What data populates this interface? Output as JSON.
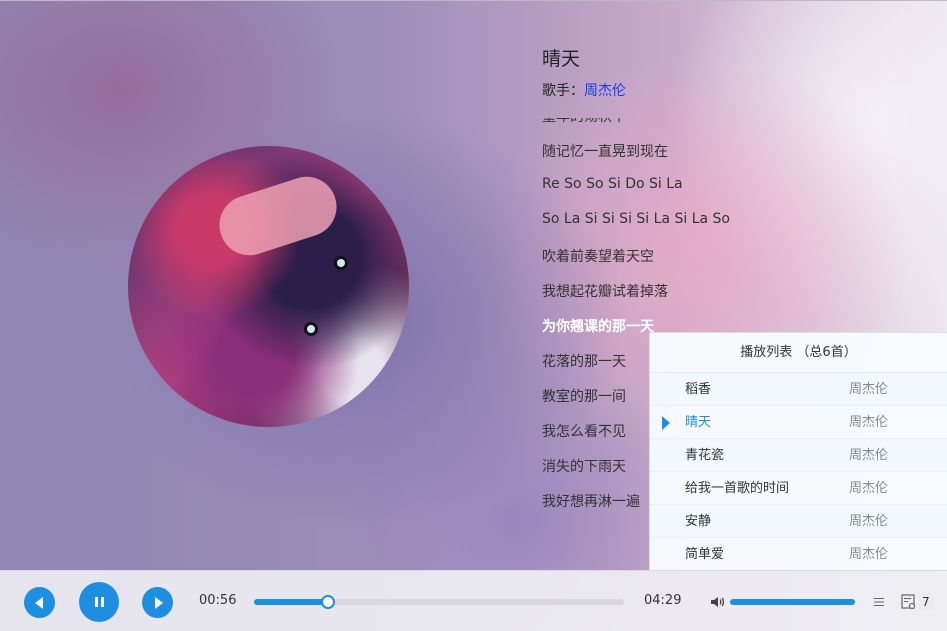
{
  "song": {
    "title": "晴天",
    "singer_label": "歌手：",
    "singer": "周杰伦"
  },
  "lyrics": {
    "lines": [
      "童年的荡秋千",
      "随记忆一直晃到现在",
      "Re So So Si Do Si La",
      "So La Si Si Si Si La Si La So",
      "吹着前奏望着天空",
      "我想起花瓣试着掉落",
      "为你翘课的那一天",
      "花落的那一天",
      "教室的那一间",
      "我怎么看不见",
      "消失的下雨天",
      "我好想再淋一遍"
    ],
    "active_index": 6
  },
  "playlist": {
    "header": "播放列表 （总6首）",
    "songs": [
      {
        "name": "稻香",
        "artist": "周杰伦",
        "playing": false
      },
      {
        "name": "晴天",
        "artist": "周杰伦",
        "playing": true
      },
      {
        "name": "青花瓷",
        "artist": "周杰伦",
        "playing": false
      },
      {
        "name": "给我一首歌的时间",
        "artist": "周杰伦",
        "playing": false
      },
      {
        "name": "安静",
        "artist": "周杰伦",
        "playing": false
      },
      {
        "name": "简单爱",
        "artist": "周杰伦",
        "playing": false
      }
    ]
  },
  "player": {
    "current_time": "00:56",
    "total_time": "04:29",
    "progress_fraction": 0.2,
    "volume_fraction": 1.0,
    "playlist_count": "7",
    "accent_color": "#1e8fe0",
    "icons": [
      "prev-icon",
      "pause-icon",
      "next-icon",
      "volume-icon",
      "play-mode-icon",
      "playlist-icon"
    ]
  }
}
